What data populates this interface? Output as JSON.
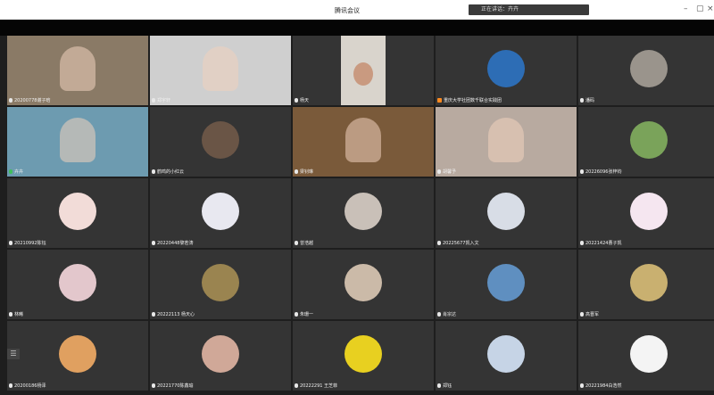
{
  "window": {
    "title": "腾讯会议",
    "speaking_banner": "正在讲话：卉卉",
    "controls": [
      "–",
      "▢",
      "×"
    ]
  },
  "colors": {
    "tile_bg": "#343434",
    "title_bar": "#ffffff",
    "top_bar": "#050505",
    "hand_icon": "#ff8a1f"
  },
  "participants": [
    {
      "name": "20200778谢子晗",
      "kind": "video",
      "tone": "#8a7a66"
    },
    {
      "name": "郑宇轩",
      "kind": "video",
      "tone": "#cfcfcf"
    },
    {
      "name": "杨天",
      "kind": "video-small",
      "tone": "#d9d4cc"
    },
    {
      "name": "重庆大学社团数千联合实践团",
      "kind": "avatar",
      "tone": "#2d6db5",
      "hand": true
    },
    {
      "name": "潘码",
      "kind": "avatar",
      "tone": "#9a948c"
    },
    {
      "name": "卉卉",
      "kind": "video",
      "tone": "#6d9bb0",
      "mic_green": true
    },
    {
      "name": "鹤鸣的小红云",
      "kind": "avatar",
      "tone": "#6a5546"
    },
    {
      "name": "梁钊琳",
      "kind": "video",
      "tone": "#7a5a3a"
    },
    {
      "name": "胡馨予",
      "kind": "video",
      "tone": "#b8aaa0"
    },
    {
      "name": "20226096张梓钧",
      "kind": "avatar",
      "tone": "#7aa35a"
    },
    {
      "name": "20210992陈钰",
      "kind": "avatar",
      "tone": "#f2dcd8"
    },
    {
      "name": "20220448黎若涛",
      "kind": "avatar",
      "tone": "#e8e8f0"
    },
    {
      "name": "曾浩越",
      "kind": "avatar",
      "tone": "#c9c0b8"
    },
    {
      "name": "20225677凯入文",
      "kind": "avatar",
      "tone": "#d8dde6"
    },
    {
      "name": "20221424曹子凯",
      "kind": "avatar",
      "tone": "#f5e6f0"
    },
    {
      "name": "林晞",
      "kind": "avatar",
      "tone": "#e3c7cc"
    },
    {
      "name": "20222113 杨天心",
      "kind": "avatar",
      "tone": "#9a8450"
    },
    {
      "name": "朱珊一",
      "kind": "avatar",
      "tone": "#cbbaa8"
    },
    {
      "name": "肖宗达",
      "kind": "avatar",
      "tone": "#5f8fc0"
    },
    {
      "name": "高晋军",
      "kind": "avatar",
      "tone": "#c9b070"
    },
    {
      "name": "20200186杨泽",
      "kind": "avatar",
      "tone": "#e0a060"
    },
    {
      "name": "20221770陈鑫瑜",
      "kind": "avatar",
      "tone": "#d0a898"
    },
    {
      "name": "20222291 王芝菲",
      "kind": "avatar",
      "tone": "#e8d020"
    },
    {
      "name": "郑钰",
      "kind": "avatar",
      "tone": "#c6d4e6"
    },
    {
      "name": "20221984白浩然",
      "kind": "avatar",
      "tone": "#f4f4f4"
    }
  ]
}
